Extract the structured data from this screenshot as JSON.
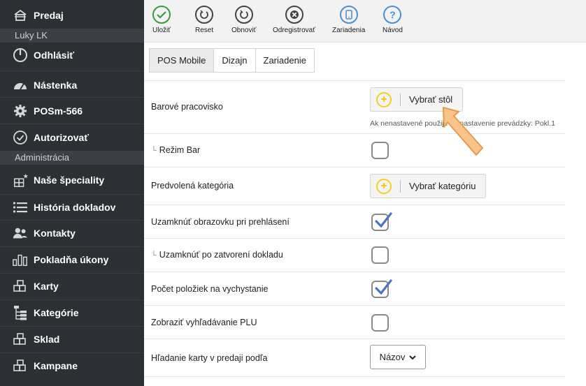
{
  "sidebar": {
    "top_item": "Predaj",
    "user_section": "Luky LK",
    "items_a": [
      "Odhlásiť",
      "Nástenka",
      "POSm-566",
      "Autorizovať"
    ],
    "admin_section": "Administrácia",
    "items_b": [
      "Naše špeciality",
      "História dokladov",
      "Kontakty",
      "Pokladňa úkony",
      "Karty",
      "Kategórie",
      "Sklad",
      "Kampane"
    ]
  },
  "toolbar": {
    "save": "Uložiť",
    "reset": "Reset",
    "refresh": "Obnoviť",
    "unregister": "Odregistrovať",
    "devices": "Zariadenia",
    "guide": "Návod",
    "colors": {
      "save": "#3a9b3a",
      "devices": "#4a8fd6",
      "guide": "#4a8fd6"
    }
  },
  "tabs": {
    "pos_mobile": "POS Mobile",
    "design": "Dizajn",
    "device": "Zariadenie"
  },
  "settings": {
    "bar_workplace": "Barové pracovisko",
    "select_table": "Vybrať stôl",
    "hint": "Ak nenastavené použije sa nastavenie prevádzky: Pokl.1",
    "bar_mode": "Režim Bar",
    "default_category": "Predvolená kategória",
    "select_category": "Vybrať kategóriu",
    "lock_on_login": "Uzamknúť obrazovku pri prehlásení",
    "lock_on_close": "Uzamknúť po zatvorení dokladu",
    "items_count": "Počet položiek na vychystanie",
    "show_plu_search": "Zobraziť vyhľadávanie PLU",
    "search_by": "Hľadanie karty v predaji podľa",
    "search_by_value": "Názov",
    "sub_marker": "└"
  }
}
